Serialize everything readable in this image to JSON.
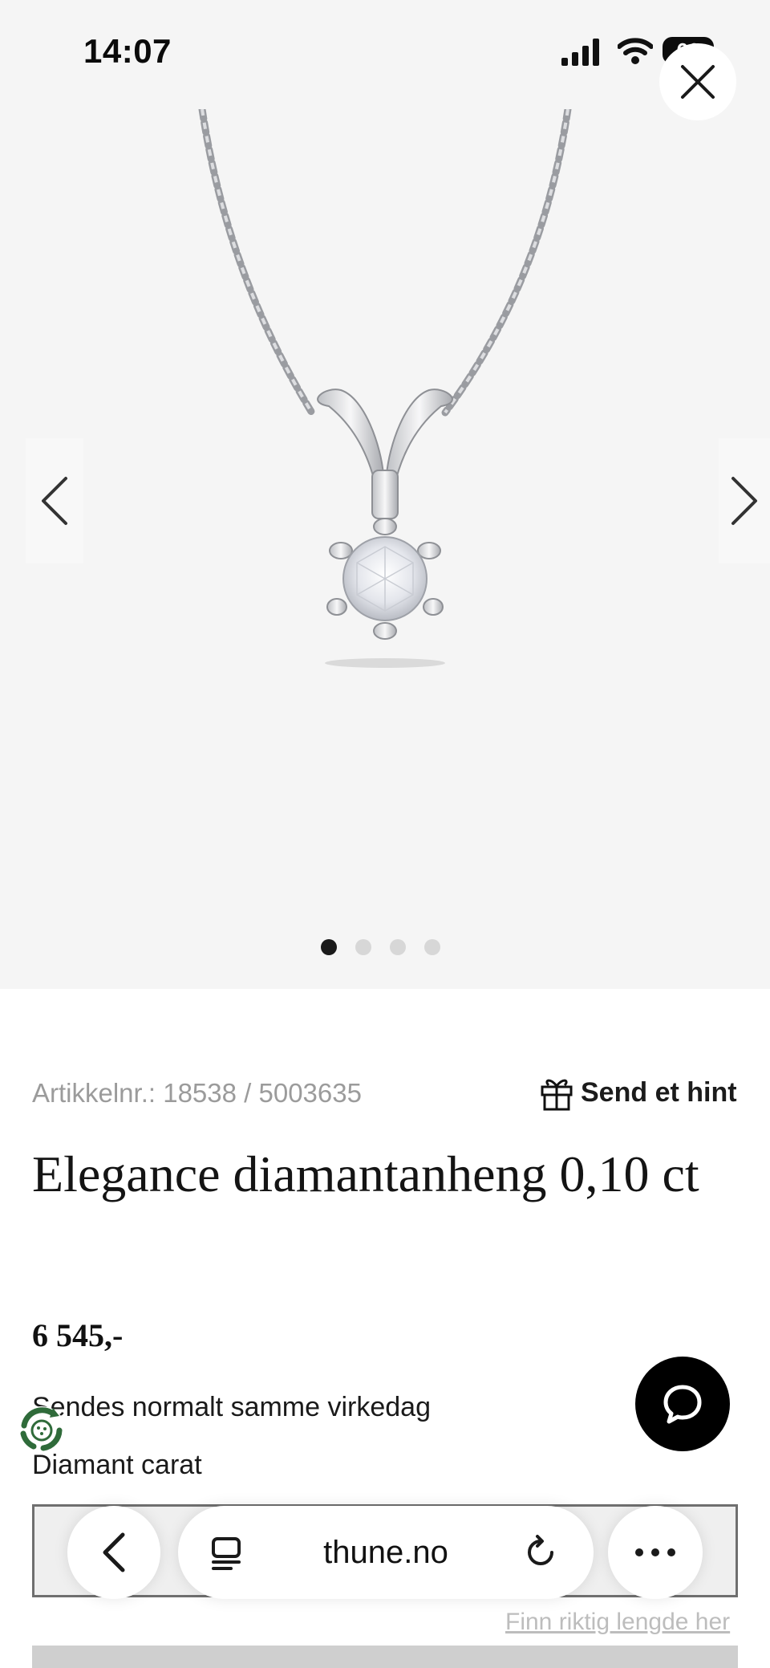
{
  "status_bar": {
    "time": "14:07",
    "battery": "66"
  },
  "gallery": {
    "image_alt": "Elegance diamantanheng",
    "dots_count": 4,
    "active_dot": 1
  },
  "product": {
    "article_number": "Artikkelnr.: 18538 / 5003635",
    "hint_label": "Send et hint",
    "title": "Elegance diamantanheng 0,10 ct",
    "price": "6 545,-",
    "shipping": "Sendes normalt samme virkedag",
    "carat_label": "Diamant carat",
    "size_link": "Finn riktig lengde her"
  },
  "browser": {
    "url": "thune.no"
  },
  "colors": {
    "gallery_bg": "#f5f5f5",
    "chat_button": "#000000",
    "eco_badge": "#2f6b3a",
    "muted_text": "#9b9b9b"
  },
  "icons": [
    "close-icon",
    "chevron-left-icon",
    "chevron-right-icon",
    "gift-icon",
    "chat-icon",
    "recycle-icon",
    "back-icon",
    "reader-icon",
    "reload-icon",
    "more-icon"
  ]
}
